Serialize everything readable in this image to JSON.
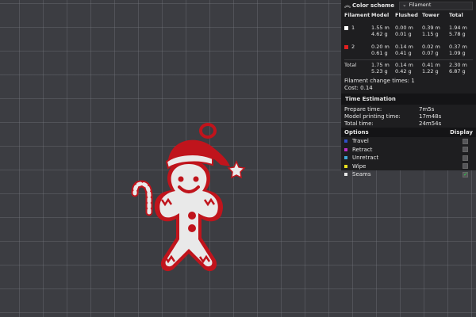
{
  "legend": {
    "title": "Color scheme",
    "scheme_value": "Filament",
    "columns": [
      "Filament",
      "Model",
      "Flushed",
      "Tower",
      "Total"
    ],
    "filaments": [
      {
        "id": "1",
        "color": "#ffffff",
        "model": [
          "1.55 m",
          "4.62 g"
        ],
        "flushed": [
          "0.00 m",
          "0.01 g"
        ],
        "tower": [
          "0.39 m",
          "1.15 g"
        ],
        "total": [
          "1.94 m",
          "5.78 g"
        ]
      },
      {
        "id": "2",
        "color": "#e02020",
        "model": [
          "0.20 m",
          "0.61 g"
        ],
        "flushed": [
          "0.14 m",
          "0.41 g"
        ],
        "tower": [
          "0.02 m",
          "0.07 g"
        ],
        "total": [
          "0.37 m",
          "1.09 g"
        ]
      }
    ],
    "total_row": {
      "label": "Total",
      "model": [
        "1.75 m",
        "5.23 g"
      ],
      "flushed": [
        "0.14 m",
        "0.42 g"
      ],
      "tower": [
        "0.41 m",
        "1.22 g"
      ],
      "total": [
        "2.30 m",
        "6.87 g"
      ]
    },
    "change_times": "Filament change times:  1",
    "cost": "Cost:  0.14"
  },
  "time": {
    "title": "Time Estimation",
    "rows": [
      {
        "label": "Prepare time:",
        "value": "7m5s"
      },
      {
        "label": "Model printing time:",
        "value": "17m48s"
      },
      {
        "label": "Total time:",
        "value": "24m54s"
      }
    ]
  },
  "options": {
    "title": "Options",
    "display_label": "Display",
    "items": [
      {
        "label": "Travel",
        "color": "#3050c8",
        "checked": false
      },
      {
        "label": "Retract",
        "color": "#c030c8",
        "checked": false
      },
      {
        "label": "Unretract",
        "color": "#40a8d8",
        "checked": false
      },
      {
        "label": "Wipe",
        "color": "#e8e020",
        "checked": false
      },
      {
        "label": "Seams",
        "color": "#e8e8e8",
        "checked": true
      }
    ]
  },
  "colors": {
    "filament_red": "#c0141c",
    "filament_white": "#e9e9e9",
    "grid_bg": "#3c3d42"
  }
}
